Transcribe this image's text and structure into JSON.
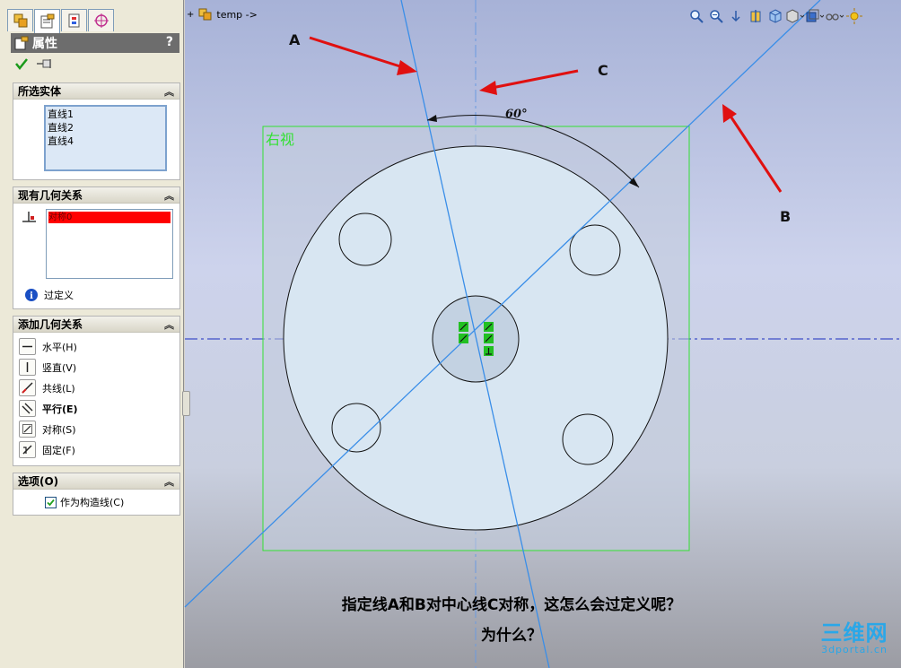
{
  "panel": {
    "title": "属性",
    "help": "?",
    "groups": {
      "selected": {
        "title": "所选实体",
        "items": [
          "直线1",
          "直线2",
          "直线4"
        ]
      },
      "existing": {
        "title": "现有几何关系",
        "item": "对称0",
        "status": "过定义"
      },
      "add": {
        "title": "添加几何关系",
        "items": [
          "水平(H)",
          "竖直(V)",
          "共线(L)",
          "平行(E)",
          "对称(S)",
          "固定(F)"
        ]
      },
      "options": {
        "title": "选项(O)",
        "checkbox": "作为构造线(C)"
      }
    }
  },
  "tree": {
    "label": "temp ->"
  },
  "viewport": {
    "view_name": "右视",
    "angle": "60°",
    "labels": {
      "a": "A",
      "b": "B",
      "c": "C"
    },
    "caption_line1": "指定线A和B对中心线C对称，这怎么会过定义呢？",
    "caption_line2": "为什么？"
  },
  "watermark": {
    "big": "三维网",
    "small": "3dportal.cn"
  },
  "colors": {
    "panel_bg": "#ece9d8",
    "frame_green": "#33e033",
    "construction_line": "#3a8ee8",
    "centerline": "#1a2dbf",
    "arrow_red": "#e01010",
    "error_red": "#ff0000",
    "watermark": "#2aa7e8"
  }
}
